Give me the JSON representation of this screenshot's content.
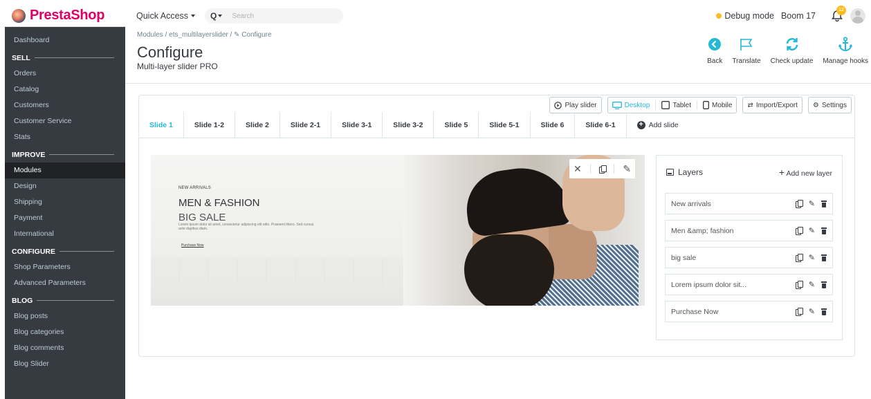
{
  "brand": {
    "logo_text": "PrestaShop"
  },
  "sidebar": {
    "items": [
      {
        "type": "item",
        "label": "Dashboard"
      },
      {
        "type": "head",
        "label": "SELL"
      },
      {
        "type": "item",
        "label": "Orders"
      },
      {
        "type": "item",
        "label": "Catalog"
      },
      {
        "type": "item",
        "label": "Customers"
      },
      {
        "type": "item",
        "label": "Customer Service"
      },
      {
        "type": "item",
        "label": "Stats"
      },
      {
        "type": "head",
        "label": "IMPROVE"
      },
      {
        "type": "item",
        "label": "Modules",
        "active": true
      },
      {
        "type": "item",
        "label": "Design"
      },
      {
        "type": "item",
        "label": "Shipping"
      },
      {
        "type": "item",
        "label": "Payment"
      },
      {
        "type": "item",
        "label": "International"
      },
      {
        "type": "head",
        "label": "CONFIGURE"
      },
      {
        "type": "item",
        "label": "Shop Parameters"
      },
      {
        "type": "item",
        "label": "Advanced Parameters"
      },
      {
        "type": "head",
        "label": "BLOG"
      },
      {
        "type": "item",
        "label": "Blog posts"
      },
      {
        "type": "item",
        "label": "Blog categories"
      },
      {
        "type": "item",
        "label": "Blog comments"
      },
      {
        "type": "item",
        "label": "Blog Slider"
      }
    ]
  },
  "topbar": {
    "quick_access": "Quick Access",
    "search_placeholder": "Search",
    "debug_mode": "Debug mode",
    "shop_name": "Boom 17",
    "notification_count": "12"
  },
  "header": {
    "breadcrumb": "Modules / ets_multilayerslider / ✎ Configure",
    "title": "Configure",
    "subtitle": "Multi-layer slider PRO",
    "toolbar": {
      "back": "Back",
      "translate": "Translate",
      "check_update": "Check update",
      "manage_hooks": "Manage hooks"
    }
  },
  "panel": {
    "play_slider": "Play slider",
    "desktop": "Desktop",
    "tablet": "Tablet",
    "mobile": "Mobile",
    "import_export": "Import/Export",
    "settings": "Settings",
    "tabs": [
      "Slide 1",
      "Slide 1-2",
      "Slide 2",
      "Slide 2-1",
      "Slide 3-1",
      "Slide 3-2",
      "Slide 5",
      "Slide 5-1",
      "Slide 6",
      "Slide 6-1"
    ],
    "active_tab": 0,
    "add_slide": "Add slide"
  },
  "slide": {
    "small": "NEW ARRIVALS",
    "title": "MEN & FASHION",
    "subtitle": "BIG SALE",
    "lorem": "Lorem ipsum dolor sit amet, consectetur adipiscing elit odio. Praesent libero. Sed cursus ante dapibus diam.",
    "button": "Purchase Now"
  },
  "layers": {
    "title": "Layers",
    "add_label": "Add new layer",
    "items": [
      "New arrivals",
      "Men &amp; fashion",
      "big sale",
      "Lorem ipsum dolor sit...",
      "Purchase Now"
    ]
  },
  "colors": {
    "accent": "#25b9d7",
    "sidebar": "#363a41",
    "brand": "#df0067"
  }
}
